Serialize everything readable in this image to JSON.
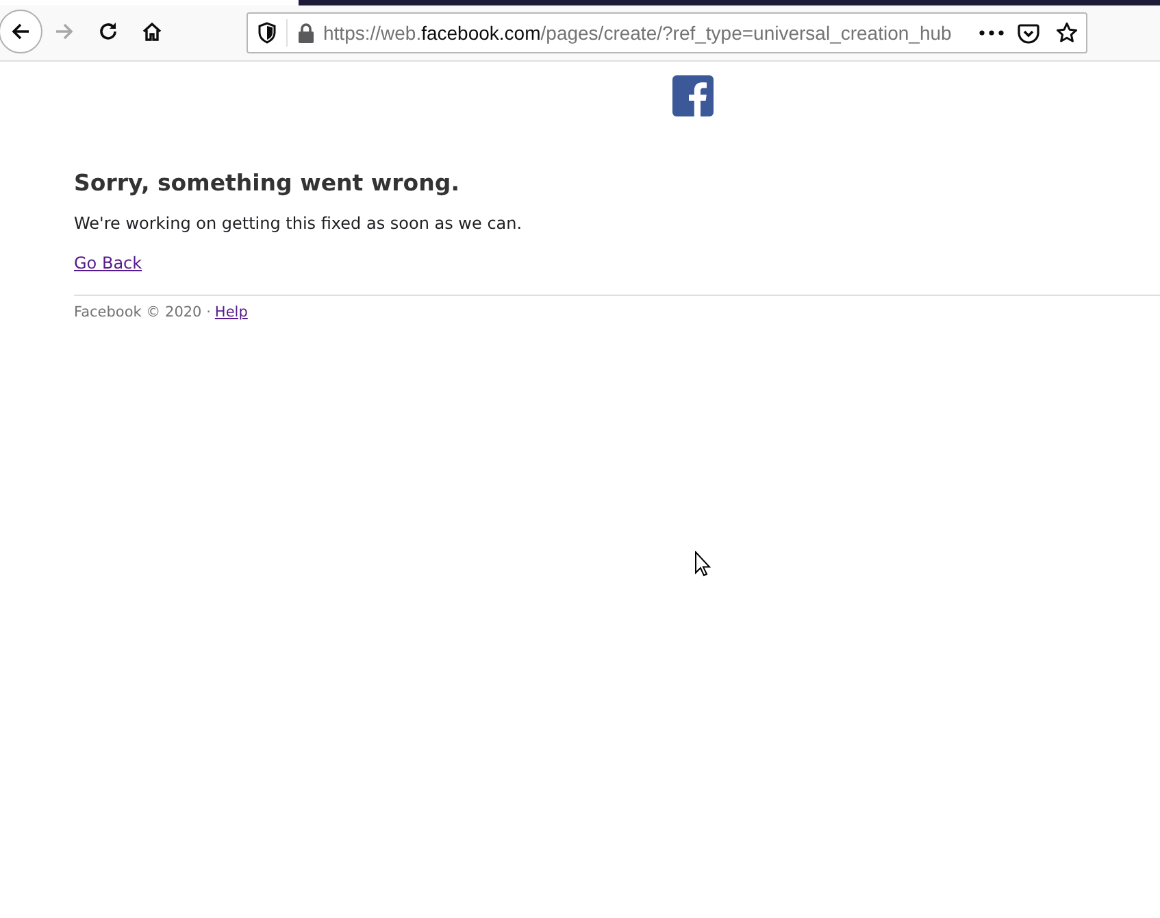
{
  "browser": {
    "url": {
      "prefix": "https://web.",
      "domain": "facebook.com",
      "path": "/pages/create/?ref_type=universal_creation_hub"
    },
    "forward_disabled": true
  },
  "error": {
    "title": "Sorry, something went wrong.",
    "message": "We're working on getting this fixed as soon as we can.",
    "link": "Go Back"
  },
  "footer": {
    "text": "Facebook © 2020 ·",
    "link": "Help"
  }
}
